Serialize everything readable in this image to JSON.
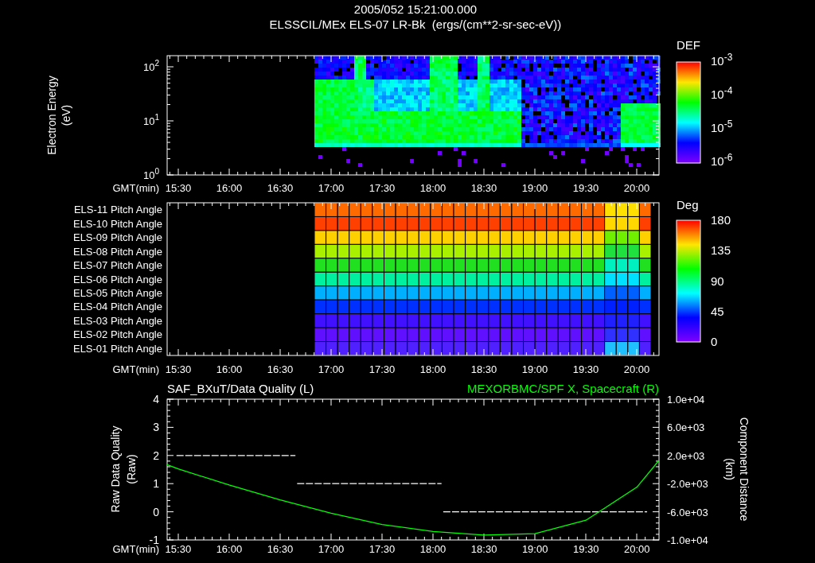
{
  "header": {
    "title": "2005/052 15:21:00.000",
    "subtitle": "ELSSCIL/MEx ELS-07 LR-Bk  (ergs/(cm**2-sr-sec-eV))"
  },
  "spectrogram_panel": {
    "ylabel": "Electron Energy",
    "yunit": "(eV)",
    "yticks": [
      {
        "base": "10",
        "exponent": "2"
      },
      {
        "base": "10",
        "exponent": "1"
      },
      {
        "base": "10",
        "exponent": "0"
      }
    ],
    "colorbar": {
      "title": "DEF",
      "ticks": [
        {
          "base": "10",
          "exponent": "-3"
        },
        {
          "base": "10",
          "exponent": "-4"
        },
        {
          "base": "10",
          "exponent": "-5"
        },
        {
          "base": "10",
          "exponent": "-6"
        }
      ]
    },
    "time_axis": {
      "label": "GMT(min)",
      "ticks": [
        "15:30",
        "16:00",
        "16:30",
        "17:00",
        "17:30",
        "18:00",
        "18:30",
        "19:00",
        "19:30",
        "20:00"
      ]
    }
  },
  "pitch_angle_panel": {
    "rows": [
      "ELS-11 Pitch Angle",
      "ELS-10 Pitch Angle",
      "ELS-09 Pitch Angle",
      "ELS-08 Pitch Angle",
      "ELS-07 Pitch Angle",
      "ELS-06 Pitch Angle",
      "ELS-05 Pitch Angle",
      "ELS-04 Pitch Angle",
      "ELS-03 Pitch Angle",
      "ELS-02 Pitch Angle",
      "ELS-01 Pitch Angle"
    ],
    "colorbar": {
      "title": "Deg",
      "ticks": [
        "180",
        "135",
        "90",
        "45",
        "0"
      ]
    },
    "time_axis": {
      "label": "GMT(min)",
      "ticks": [
        "15:30",
        "16:00",
        "16:30",
        "17:00",
        "17:30",
        "18:00",
        "18:30",
        "19:00",
        "19:30",
        "20:00"
      ]
    }
  },
  "quality_panel": {
    "chart_data": {
      "type": "line",
      "xlabel": "GMT(min)",
      "ylabel": "Raw Data Quality",
      "x": [
        929,
        999,
        1000,
        1085,
        1086,
        1206
      ],
      "series": [
        {
          "name": "SAF_BXuT/Data Quality (L)",
          "color": "#ffffff",
          "line_style": "dashed",
          "values": [
            2,
            2,
            1,
            1,
            0,
            0
          ]
        }
      ],
      "xlim": [
        923.5,
        1213
      ],
      "ylim": [
        -1,
        4
      ],
      "xticks": [
        {
          "value": 930,
          "label": "15:30"
        },
        {
          "value": 960,
          "label": "16:00"
        },
        {
          "value": 990,
          "label": "16:30"
        },
        {
          "value": 1020,
          "label": "17:00"
        },
        {
          "value": 1050,
          "label": "17:30"
        },
        {
          "value": 1080,
          "label": "18:00"
        },
        {
          "value": 1110,
          "label": "18:30"
        },
        {
          "value": 1140,
          "label": "19:00"
        },
        {
          "value": 1170,
          "label": "19:30"
        },
        {
          "value": 1200,
          "label": "20:00"
        }
      ],
      "yticks": [
        -1,
        0,
        1,
        2,
        3,
        4
      ]
    },
    "ylabel_unit": "(Raw)",
    "right_chart": {
      "unit": "(km)",
      "chart_data": {
        "type": "line",
        "ylabel": "Component Distance",
        "x": [
          923.5,
          930,
          960,
          990,
          1020,
          1050,
          1080,
          1110,
          1140,
          1170,
          1200,
          1213
        ],
        "series": [
          {
            "name": "MEXORBMC/SPF X, Spacecraft (R)",
            "color": "#00ff00",
            "line_style": "solid",
            "values": [
              700,
              100,
              -2200,
              -4300,
              -6200,
              -7800,
              -8800,
              -9300,
              -9100,
              -7200,
              -2500,
              1300
            ]
          }
        ],
        "xlim": [
          923.5,
          1213
        ],
        "ylim": [
          -10000,
          10000
        ],
        "yticks": [
          {
            "value": 10000,
            "label": "1.0e+04"
          },
          {
            "value": 6000,
            "label": "6.0e+03"
          },
          {
            "value": 2000,
            "label": "2.0e+03"
          },
          {
            "value": -2000,
            "label": "-2.0e+03"
          },
          {
            "value": -6000,
            "label": "-6.0e+03"
          },
          {
            "value": -10000,
            "label": "-1.0e+04"
          }
        ]
      }
    }
  }
}
